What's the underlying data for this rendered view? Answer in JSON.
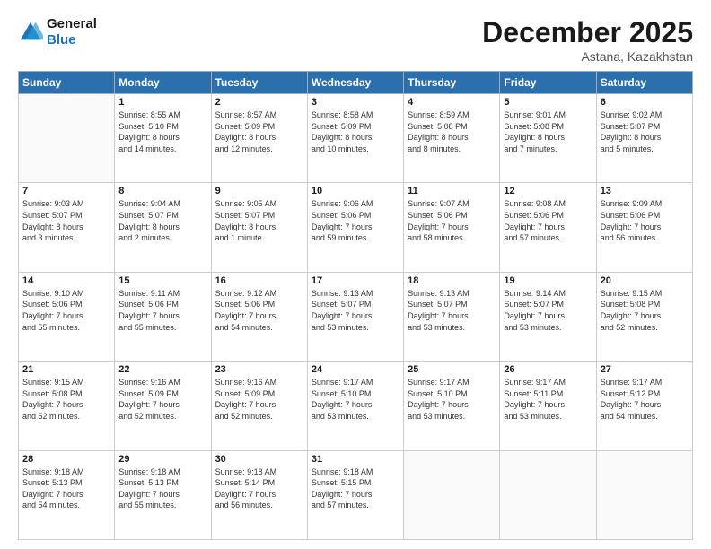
{
  "logo": {
    "line1": "General",
    "line2": "Blue"
  },
  "title": "December 2025",
  "subtitle": "Astana, Kazakhstan",
  "weekdays": [
    "Sunday",
    "Monday",
    "Tuesday",
    "Wednesday",
    "Thursday",
    "Friday",
    "Saturday"
  ],
  "weeks": [
    [
      {
        "day": "",
        "info": ""
      },
      {
        "day": "1",
        "info": "Sunrise: 8:55 AM\nSunset: 5:10 PM\nDaylight: 8 hours\nand 14 minutes."
      },
      {
        "day": "2",
        "info": "Sunrise: 8:57 AM\nSunset: 5:09 PM\nDaylight: 8 hours\nand 12 minutes."
      },
      {
        "day": "3",
        "info": "Sunrise: 8:58 AM\nSunset: 5:09 PM\nDaylight: 8 hours\nand 10 minutes."
      },
      {
        "day": "4",
        "info": "Sunrise: 8:59 AM\nSunset: 5:08 PM\nDaylight: 8 hours\nand 8 minutes."
      },
      {
        "day": "5",
        "info": "Sunrise: 9:01 AM\nSunset: 5:08 PM\nDaylight: 8 hours\nand 7 minutes."
      },
      {
        "day": "6",
        "info": "Sunrise: 9:02 AM\nSunset: 5:07 PM\nDaylight: 8 hours\nand 5 minutes."
      }
    ],
    [
      {
        "day": "7",
        "info": "Sunrise: 9:03 AM\nSunset: 5:07 PM\nDaylight: 8 hours\nand 3 minutes."
      },
      {
        "day": "8",
        "info": "Sunrise: 9:04 AM\nSunset: 5:07 PM\nDaylight: 8 hours\nand 2 minutes."
      },
      {
        "day": "9",
        "info": "Sunrise: 9:05 AM\nSunset: 5:07 PM\nDaylight: 8 hours\nand 1 minute."
      },
      {
        "day": "10",
        "info": "Sunrise: 9:06 AM\nSunset: 5:06 PM\nDaylight: 7 hours\nand 59 minutes."
      },
      {
        "day": "11",
        "info": "Sunrise: 9:07 AM\nSunset: 5:06 PM\nDaylight: 7 hours\nand 58 minutes."
      },
      {
        "day": "12",
        "info": "Sunrise: 9:08 AM\nSunset: 5:06 PM\nDaylight: 7 hours\nand 57 minutes."
      },
      {
        "day": "13",
        "info": "Sunrise: 9:09 AM\nSunset: 5:06 PM\nDaylight: 7 hours\nand 56 minutes."
      }
    ],
    [
      {
        "day": "14",
        "info": "Sunrise: 9:10 AM\nSunset: 5:06 PM\nDaylight: 7 hours\nand 55 minutes."
      },
      {
        "day": "15",
        "info": "Sunrise: 9:11 AM\nSunset: 5:06 PM\nDaylight: 7 hours\nand 55 minutes."
      },
      {
        "day": "16",
        "info": "Sunrise: 9:12 AM\nSunset: 5:06 PM\nDaylight: 7 hours\nand 54 minutes."
      },
      {
        "day": "17",
        "info": "Sunrise: 9:13 AM\nSunset: 5:07 PM\nDaylight: 7 hours\nand 53 minutes."
      },
      {
        "day": "18",
        "info": "Sunrise: 9:13 AM\nSunset: 5:07 PM\nDaylight: 7 hours\nand 53 minutes."
      },
      {
        "day": "19",
        "info": "Sunrise: 9:14 AM\nSunset: 5:07 PM\nDaylight: 7 hours\nand 53 minutes."
      },
      {
        "day": "20",
        "info": "Sunrise: 9:15 AM\nSunset: 5:08 PM\nDaylight: 7 hours\nand 52 minutes."
      }
    ],
    [
      {
        "day": "21",
        "info": "Sunrise: 9:15 AM\nSunset: 5:08 PM\nDaylight: 7 hours\nand 52 minutes."
      },
      {
        "day": "22",
        "info": "Sunrise: 9:16 AM\nSunset: 5:09 PM\nDaylight: 7 hours\nand 52 minutes."
      },
      {
        "day": "23",
        "info": "Sunrise: 9:16 AM\nSunset: 5:09 PM\nDaylight: 7 hours\nand 52 minutes."
      },
      {
        "day": "24",
        "info": "Sunrise: 9:17 AM\nSunset: 5:10 PM\nDaylight: 7 hours\nand 53 minutes."
      },
      {
        "day": "25",
        "info": "Sunrise: 9:17 AM\nSunset: 5:10 PM\nDaylight: 7 hours\nand 53 minutes."
      },
      {
        "day": "26",
        "info": "Sunrise: 9:17 AM\nSunset: 5:11 PM\nDaylight: 7 hours\nand 53 minutes."
      },
      {
        "day": "27",
        "info": "Sunrise: 9:17 AM\nSunset: 5:12 PM\nDaylight: 7 hours\nand 54 minutes."
      }
    ],
    [
      {
        "day": "28",
        "info": "Sunrise: 9:18 AM\nSunset: 5:13 PM\nDaylight: 7 hours\nand 54 minutes."
      },
      {
        "day": "29",
        "info": "Sunrise: 9:18 AM\nSunset: 5:13 PM\nDaylight: 7 hours\nand 55 minutes."
      },
      {
        "day": "30",
        "info": "Sunrise: 9:18 AM\nSunset: 5:14 PM\nDaylight: 7 hours\nand 56 minutes."
      },
      {
        "day": "31",
        "info": "Sunrise: 9:18 AM\nSunset: 5:15 PM\nDaylight: 7 hours\nand 57 minutes."
      },
      {
        "day": "",
        "info": ""
      },
      {
        "day": "",
        "info": ""
      },
      {
        "day": "",
        "info": ""
      }
    ]
  ]
}
